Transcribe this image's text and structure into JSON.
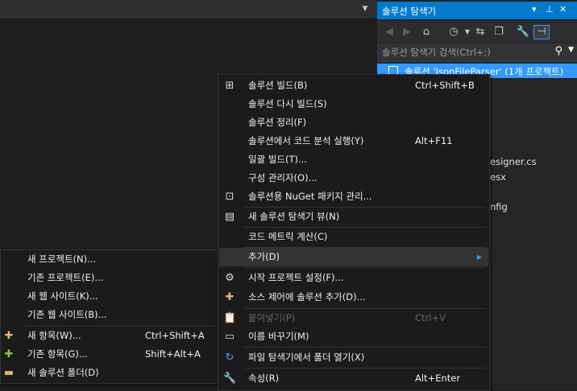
{
  "solution_explorer": {
    "title": "솔루션 탐색기",
    "pin_icon": "▾",
    "search_placeholder": "솔루션 탐색기 검색(Ctrl+;)",
    "selected_item": "솔루션 'JsonFileParser' (1개 프로젝트)",
    "tree": [
      "esigner.cs",
      "esx",
      "nfig"
    ]
  },
  "context_menu": {
    "items": [
      {
        "label": "솔루션 빌드(B)",
        "shortcut": "Ctrl+Shift+B",
        "icon": "build-icon"
      },
      {
        "label": "솔루션 다시 빌드(S)",
        "shortcut": ""
      },
      {
        "label": "솔루션 정리(F)",
        "shortcut": ""
      },
      {
        "label": "솔루션에서 코드 분석 실행(Y)",
        "shortcut": "Alt+F11"
      },
      {
        "label": "일괄 빌드(T)...",
        "shortcut": ""
      },
      {
        "label": "구성 관리자(O)...",
        "shortcut": ""
      },
      {
        "label": "솔루션용 NuGet 패키지 관리...",
        "shortcut": "",
        "icon": "nuget-icon"
      },
      {
        "label": "새 솔루션 탐색기 뷰(N)",
        "shortcut": "",
        "icon": "new-view-icon"
      },
      {
        "label": "코드 메트릭 계산(C)",
        "shortcut": ""
      },
      {
        "label": "추가(D)",
        "shortcut": ""
      },
      {
        "label": "시작 프로젝트 설정(F)...",
        "shortcut": "",
        "icon": "gear-icon"
      },
      {
        "label": "소스 제어에 솔루션 추가(D)...",
        "shortcut": "",
        "icon": "source-control-icon"
      },
      {
        "label": "붙여넣기(P)",
        "shortcut": "Ctrl+V",
        "icon": "paste-icon"
      },
      {
        "label": "이름 바꾸기(M)",
        "shortcut": "",
        "icon": "rename-icon"
      },
      {
        "label": "파일 탐색기에서 폴더 열기(X)",
        "shortcut": "",
        "icon": "refresh-arrow-icon"
      },
      {
        "label": "속성(R)",
        "shortcut": "Alt+Enter",
        "icon": "wrench-icon"
      }
    ]
  },
  "submenu": {
    "items": [
      {
        "label": "새 프로젝트(N)...",
        "shortcut": ""
      },
      {
        "label": "기존 프로젝트(E)...",
        "shortcut": ""
      },
      {
        "label": "새 웹 사이트(K)...",
        "shortcut": ""
      },
      {
        "label": "기존 웹 사이트(B)...",
        "shortcut": ""
      },
      {
        "label": "새 항목(W)...",
        "shortcut": "Ctrl+Shift+A"
      },
      {
        "label": "기존 항목(G)...",
        "shortcut": "Shift+Alt+A"
      },
      {
        "label": "새 솔루션 폴더(D)",
        "shortcut": ""
      }
    ]
  }
}
